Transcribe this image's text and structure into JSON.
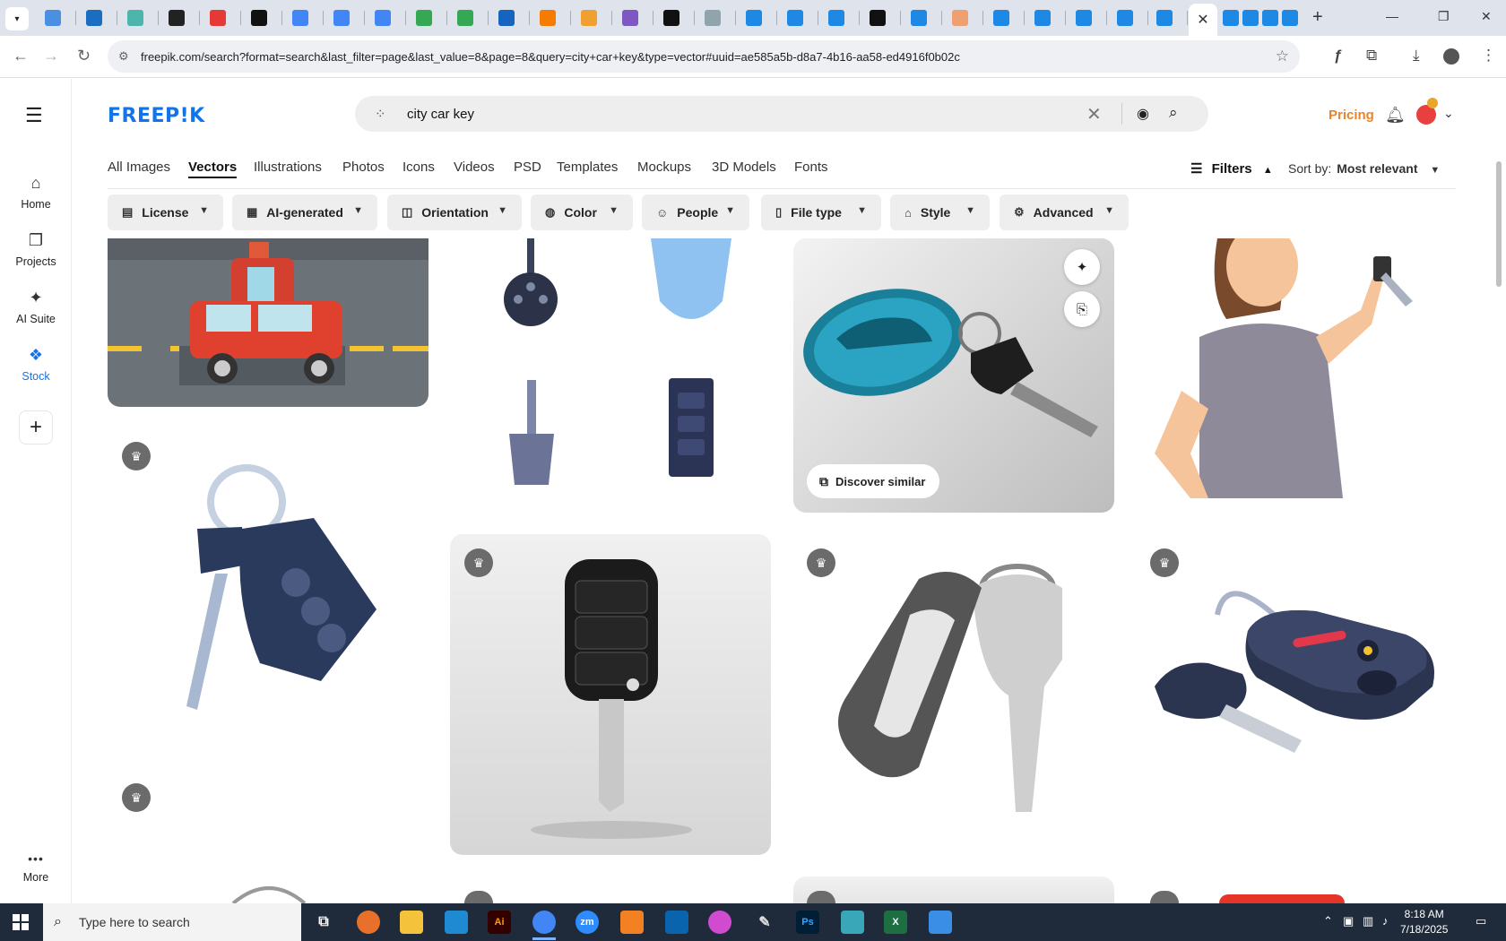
{
  "browser": {
    "url": "freepik.com/search?format=search&last_filter=page&last_value=8&page=8&query=city+car+key&type=vector#uuid=ae585a5b-d8a7-4b16-aa58-ed4916f0b02c",
    "active_tab_close": "✕",
    "new_tab": "+",
    "tab_favicon_colors": [
      "#4a90e2",
      "#1a6ec1",
      "#4db6ac",
      "#222",
      "#e53935",
      "#111",
      "#4285f4",
      "#4285f4",
      "#4285f4",
      "#34a853",
      "#34a853",
      "#1565c0",
      "#f57c00",
      "#f0a030",
      "#7e57c2",
      "#111",
      "#90a4ae",
      "#1e88e5",
      "#1e88e5",
      "#1e88e5",
      "#111",
      "#1e88e5",
      "#f0a070",
      "#1e88e5",
      "#1e88e5",
      "#1e88e5",
      "#1e88e5",
      "#1e88e5"
    ]
  },
  "rail": {
    "menu_icon": "☰",
    "items": [
      {
        "label": "Home",
        "icon": "⌂"
      },
      {
        "label": "Projects",
        "icon": "❐"
      },
      {
        "label": "AI Suite",
        "icon": "✦"
      },
      {
        "label": "Stock",
        "icon": "❖"
      },
      {
        "label": "",
        "icon": "+"
      },
      {
        "label": "More",
        "icon": "•••"
      }
    ]
  },
  "header": {
    "logo": "FREEP!K",
    "search_query": "city car key",
    "pricing": "Pricing"
  },
  "categories": [
    "All Images",
    "Vectors",
    "Illustrations",
    "Photos",
    "Icons",
    "Videos",
    "PSD",
    "Templates",
    "Mockups",
    "3D Models",
    "Fonts"
  ],
  "active_category": "Vectors",
  "filters_label": "Filters",
  "sort": {
    "label": "Sort by:",
    "value": "Most relevant"
  },
  "chips": [
    {
      "label": "License",
      "icon": "license-icon"
    },
    {
      "label": "AI-generated",
      "icon": "ai-icon"
    },
    {
      "label": "Orientation",
      "icon": "orientation-icon"
    },
    {
      "label": "Color",
      "icon": "palette-icon"
    },
    {
      "label": "People",
      "icon": "people-icon"
    },
    {
      "label": "File type",
      "icon": "file-icon"
    },
    {
      "label": "Style",
      "icon": "brush-icon"
    },
    {
      "label": "Advanced",
      "icon": "gear-icon"
    }
  ],
  "discover_similar": "Discover similar",
  "taskbar": {
    "search_placeholder": "Type here to search",
    "time": "8:18 AM",
    "date": "7/18/2025"
  }
}
